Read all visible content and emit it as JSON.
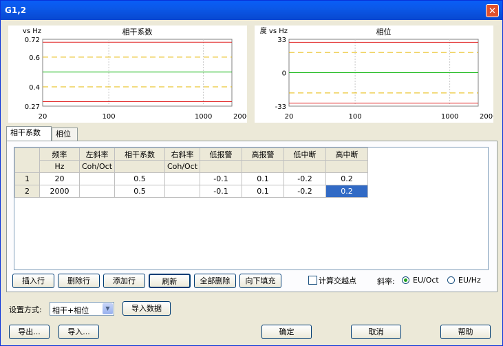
{
  "window": {
    "title": "G1,2",
    "close_symbol": "✕"
  },
  "tabs": [
    {
      "label": "相干系数"
    },
    {
      "label": "相位"
    }
  ],
  "charts": {
    "coherence": {
      "title": "相干系数",
      "unit": "vs Hz",
      "yticks": [
        "0.72",
        "0.6",
        "0.4",
        "0.27"
      ],
      "xticks": [
        "20",
        "100",
        "1000",
        "2000"
      ]
    },
    "phase": {
      "title": "相位",
      "unit": "度 vs Hz",
      "yticks": [
        "33",
        "0",
        "-33"
      ],
      "xticks": [
        "20",
        "100",
        "1000",
        "2000"
      ]
    }
  },
  "chart_data": [
    {
      "type": "line",
      "title": "相干系数",
      "ylabel": "vs Hz",
      "xscale": "log",
      "xlim": [
        20,
        2000
      ],
      "ylim": [
        0.27,
        0.72
      ],
      "series": [
        {
          "x": [
            20,
            2000
          ],
          "y": [
            0.7,
            0.7
          ],
          "color": "#e02020",
          "style": "solid"
        },
        {
          "x": [
            20,
            2000
          ],
          "y": [
            0.6,
            0.6
          ],
          "color": "#e6b800",
          "style": "dashed"
        },
        {
          "x": [
            20,
            2000
          ],
          "y": [
            0.5,
            0.5
          ],
          "color": "#00b000",
          "style": "solid"
        },
        {
          "x": [
            20,
            2000
          ],
          "y": [
            0.4,
            0.4
          ],
          "color": "#e6b800",
          "style": "dashed"
        },
        {
          "x": [
            20,
            2000
          ],
          "y": [
            0.3,
            0.3
          ],
          "color": "#e02020",
          "style": "solid"
        }
      ]
    },
    {
      "type": "line",
      "title": "相位",
      "ylabel": "度 vs Hz",
      "xscale": "log",
      "xlim": [
        20,
        2000
      ],
      "ylim": [
        -33,
        33
      ],
      "series": [
        {
          "x": [
            20,
            2000
          ],
          "y": [
            30,
            30
          ],
          "color": "#e02020",
          "style": "solid"
        },
        {
          "x": [
            20,
            2000
          ],
          "y": [
            20,
            20
          ],
          "color": "#e6b800",
          "style": "dashed"
        },
        {
          "x": [
            20,
            2000
          ],
          "y": [
            0,
            0
          ],
          "color": "#00b000",
          "style": "solid"
        },
        {
          "x": [
            20,
            2000
          ],
          "y": [
            -20,
            -20
          ],
          "color": "#e6b800",
          "style": "dashed"
        },
        {
          "x": [
            20,
            2000
          ],
          "y": [
            -30,
            -30
          ],
          "color": "#e02020",
          "style": "solid"
        }
      ]
    }
  ],
  "table": {
    "headers": [
      {
        "name": "频率",
        "unit": "Hz"
      },
      {
        "name": "左斜率",
        "unit": "Coh/Oct"
      },
      {
        "name": "相干系数",
        "unit": ""
      },
      {
        "name": "右斜率",
        "unit": "Coh/Oct"
      },
      {
        "name": "低报警",
        "unit": ""
      },
      {
        "name": "高报警",
        "unit": ""
      },
      {
        "name": "低中断",
        "unit": ""
      },
      {
        "name": "高中断",
        "unit": ""
      }
    ],
    "rows": [
      {
        "num": "1",
        "cells": [
          "20",
          "",
          "0.5",
          "",
          "-0.1",
          "0.1",
          "-0.2",
          "0.2"
        ]
      },
      {
        "num": "2",
        "cells": [
          "2000",
          "",
          "0.5",
          "",
          "-0.1",
          "0.1",
          "-0.2",
          "0.2"
        ]
      }
    ]
  },
  "buttons": {
    "insert_row": "插入行",
    "delete_row": "删除行",
    "add_row": "添加行",
    "refresh": "刷新",
    "delete_all": "全部删除",
    "fill_down": "向下填充",
    "import_data": "导入数据",
    "export": "导出...",
    "import": "导入...",
    "ok": "确定",
    "cancel": "取消",
    "help": "帮助"
  },
  "options": {
    "calc_crossing_label": "计算交越点",
    "slope_label": "斜率:",
    "slope_eu_oct": "EU/Oct",
    "slope_eu_hz": "EU/Hz",
    "setup_label": "设置方式:",
    "setup_value": "相干+相位"
  }
}
